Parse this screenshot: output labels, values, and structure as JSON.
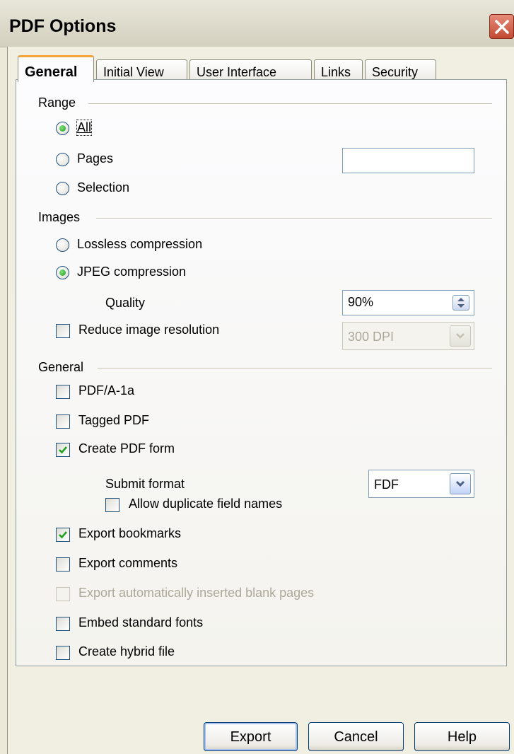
{
  "window": {
    "title": "PDF Options"
  },
  "tabs": [
    {
      "label": "General",
      "active": true
    },
    {
      "label": "Initial View"
    },
    {
      "label": "User Interface"
    },
    {
      "label": "Links"
    },
    {
      "label": "Security"
    }
  ],
  "range": {
    "group_label": "Range",
    "all": {
      "label": "All",
      "selected": true
    },
    "pages": {
      "label": "Pages",
      "value": ""
    },
    "selection": {
      "label": "Selection"
    }
  },
  "images": {
    "group_label": "Images",
    "lossless": {
      "label": "Lossless compression"
    },
    "jpeg": {
      "label": "JPEG compression",
      "selected": true
    },
    "quality_label": "Quality",
    "quality_value": "90%",
    "reduce": {
      "label": "Reduce image resolution",
      "checked": false
    },
    "resolution_value": "300 DPI"
  },
  "general": {
    "group_label": "General",
    "pdfa": {
      "label": "PDF/A-1a",
      "checked": false
    },
    "tagged": {
      "label": "Tagged PDF",
      "checked": false
    },
    "create_form": {
      "label": "Create PDF form",
      "checked": true
    },
    "submit_format_label": "Submit format",
    "submit_format_value": "FDF",
    "allow_duplicates": {
      "label": "Allow duplicate field names",
      "checked": false
    },
    "export_bookmarks": {
      "label": "Export bookmarks",
      "checked": true
    },
    "export_comments": {
      "label": "Export comments",
      "checked": false
    },
    "export_blank": {
      "label": "Export automatically inserted blank pages",
      "checked": false,
      "disabled": true
    },
    "embed_fonts": {
      "label": "Embed standard fonts",
      "checked": false
    },
    "hybrid": {
      "label": "Create hybrid file",
      "checked": false
    }
  },
  "buttons": {
    "export": "Export",
    "cancel": "Cancel",
    "help": "Help"
  },
  "colors": {
    "accent_tab": "#f3a53b",
    "radio_dot": "#21a121",
    "check_mark": "#21a121"
  }
}
